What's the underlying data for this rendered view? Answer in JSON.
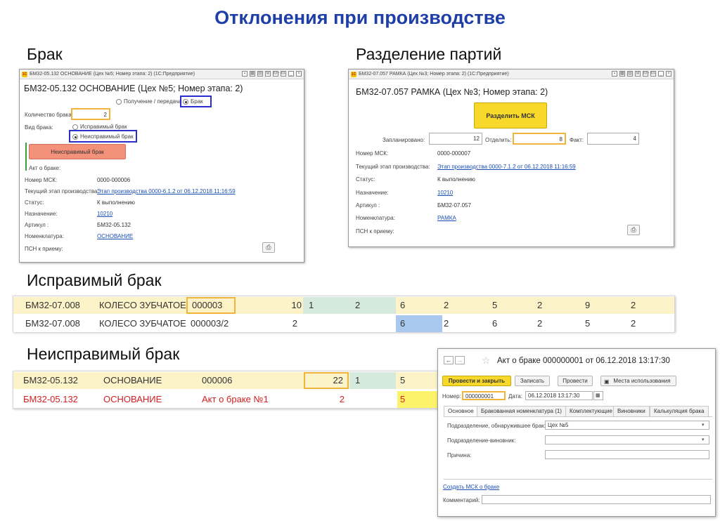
{
  "slide": {
    "title": "Отклонения при производстве",
    "sections": {
      "brak": "Брак",
      "razdelenie": "Разделение партий",
      "ispravimy": "Исправимый брак",
      "neispravimy": "Неисправимый брак"
    }
  },
  "brak_window": {
    "title": "БМ32-05.132 ОСНОВАНИЕ (Цех №5; Номер этапа: 2)  (1С:Предприятие)",
    "heading": "БМ32-05.132 ОСНОВАНИЕ (Цех №5; Номер этапа: 2)",
    "radio_receive": "Получение / передача",
    "radio_brak": "Брак",
    "qty_label": "Количество брака:",
    "qty_value": "2",
    "type_label": "Вид брака:",
    "type_fixable": "Исправимый брак",
    "type_unfixable": "Неисправимый брак",
    "action_button": "Неисправимый брак",
    "act_label": "Акт о браке:",
    "msk_label": "Номер МСК:",
    "msk_value": "0000-000006",
    "stage_label": "Текущий этап производства:",
    "stage_value": "Этап производства 0000-6.1.2 от 06.12.2018 11:16:59",
    "status_label": "Статус:",
    "status_value": "К выполнению",
    "purpose_label": "Назначение:",
    "purpose_value": "10210",
    "article_label": "Артикул :",
    "article_value": "БМ32-05.132",
    "nomen_label": "Номенклатура:",
    "nomen_value": "ОСНОВАНИЕ",
    "psn_label": "ПСН к приему:",
    "tb_icons": [
      "M",
      "M+",
      "M-"
    ]
  },
  "split_window": {
    "title": "БМ32-07.057 РАМКА (Цех №3; Номер этапа: 2)  (1С:Предприятие)",
    "heading": "БМ32-07.057 РАМКА (Цех №3; Номер этапа: 2)",
    "split_button": "Разделить МСК",
    "planned_label": "Запланировано:",
    "planned_value": "12",
    "separate_label": "Отделить:",
    "separate_value": "8",
    "fact_label": "Факт:",
    "fact_value": "4",
    "msk_label": "Номер МСК:",
    "msk_value": "0000-000007",
    "stage_label": "Текущий этап производства:",
    "stage_value": "Этап производства 0000-7.1.2 от 06.12.2018 11:16:59",
    "status_label": "Статус:",
    "status_value": "К выполнению",
    "purpose_label": "Назначение:",
    "purpose_value": "10210",
    "article_label": "Артикул :",
    "article_value": "БМ32-07.057",
    "nomen_label": "Номенклатура:",
    "nomen_value": "РАМКА",
    "psn_label": "ПСН к приему:",
    "tb_icons": [
      "M",
      "M+",
      "M-"
    ]
  },
  "fixable_table": {
    "rows": [
      [
        "БМ32-07.008",
        "КОЛЕСО ЗУБЧАТОЕ",
        "000003",
        "10",
        "1",
        "2",
        "6",
        "2",
        "5",
        "2",
        "9",
        "2"
      ],
      [
        "БМ32-07.008",
        "КОЛЕСО ЗУБЧАТОЕ",
        "000003/2",
        "2",
        "",
        "",
        "6",
        "2",
        "6",
        "2",
        "5",
        "2"
      ]
    ]
  },
  "unfixable_table": {
    "rows": [
      [
        "БМ32-05.132",
        "ОСНОВАНИЕ",
        "000006",
        "22",
        "1",
        "5"
      ],
      [
        "БМ32-05.132",
        "ОСНОВАНИЕ",
        "Акт о браке №1",
        "2",
        "",
        "5"
      ]
    ]
  },
  "act_window": {
    "title": "Акт о браке 000000001 от 06.12.2018 13:17:30",
    "btn_post_close": "Провести и закрыть",
    "btn_save": "Записать",
    "btn_post": "Провести",
    "btn_usage": "Места использования",
    "number_label": "Номер:",
    "number_value": "000000001",
    "date_label": "Дата:",
    "date_value": "06.12.2018 13:17:30",
    "tabs": [
      "Основное",
      "Бракованная номенклатура (1)",
      "Комплектующие",
      "Виновники",
      "Калькуляция брака"
    ],
    "dept_found_label": "Подразделение, обнаружившее брак:",
    "dept_found_value": "Цех №5",
    "dept_guilty_label": "Подразделение-виновник:",
    "dept_guilty_value": "",
    "reason_label": "Причина:",
    "reason_value": "",
    "create_link": "Создать МСК о браке",
    "comment_label": "Комментарий:",
    "comment_value": ""
  },
  "colors": {
    "title_blue": "#1f3fa8",
    "row_yellow": "#fdf3c9",
    "cell_green": "#d5e9dd",
    "cell_yellow": "#fdf36a",
    "cell_blue": "#a9c8ef",
    "red_text": "#d42020",
    "button_orange": "#f4917a",
    "button_yellow": "#f8d82a",
    "highlight_blue": "#2b2ecf"
  }
}
